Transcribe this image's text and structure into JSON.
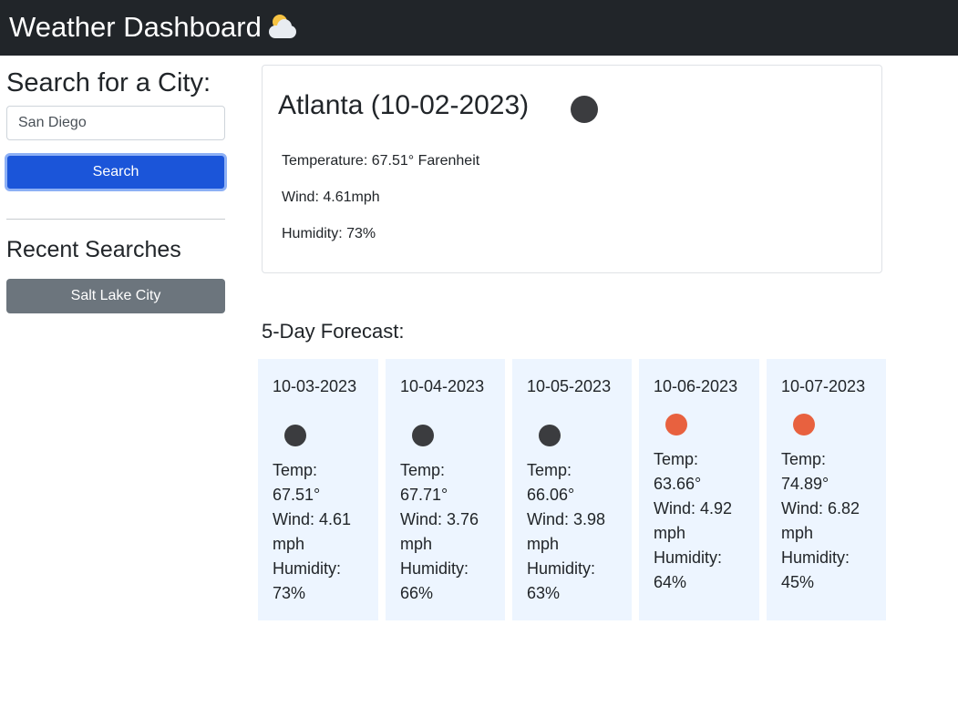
{
  "header": {
    "title": "Weather Dashboard",
    "icon": "sun-behind-cloud-icon"
  },
  "sidebar": {
    "title": "Search for a City:",
    "search_value": "San Diego",
    "search_button_label": "Search",
    "recent_title": "Recent Searches",
    "recent_items": [
      "Salt Lake City"
    ]
  },
  "current": {
    "city_date": "Atlanta (10-02-2023)",
    "icon_color": "#3b3c3f",
    "temperature": "Temperature: 67.51° Farenheit",
    "wind": "Wind: 4.61mph",
    "humidity": "Humidity: 73%"
  },
  "forecast": {
    "title": "5-Day Forecast:",
    "days": [
      {
        "date": "10-03-2023",
        "icon_color": "#3b3c3f",
        "temp_label": "Temp:",
        "temp": "67.51°",
        "wind_label": "Wind: 4.61",
        "wind_unit": "mph",
        "humidity_label": "Humidity:",
        "humidity": "73%"
      },
      {
        "date": "10-04-2023",
        "icon_color": "#3b3c3f",
        "temp_label": "Temp:",
        "temp": "67.71°",
        "wind_label": "Wind: 3.76",
        "wind_unit": "mph",
        "humidity_label": "Humidity:",
        "humidity": "66%"
      },
      {
        "date": "10-05-2023",
        "icon_color": "#3b3c3f",
        "temp_label": "Temp:",
        "temp": "66.06°",
        "wind_label": "Wind: 3.98",
        "wind_unit": "mph",
        "humidity_label": "Humidity:",
        "humidity": "63%"
      },
      {
        "date": "10-06-2023",
        "icon_color": "#e8613f",
        "temp_label": "Temp:",
        "temp": "63.66°",
        "wind_label": "Wind: 4.92",
        "wind_unit": "mph",
        "humidity_label": "Humidity:",
        "humidity": "64%"
      },
      {
        "date": "10-07-2023",
        "icon_color": "#e8613f",
        "temp_label": "Temp:",
        "temp": "74.89°",
        "wind_label": "Wind: 6.82",
        "wind_unit": "mph",
        "humidity_label": "Humidity:",
        "humidity": "45%"
      }
    ]
  }
}
